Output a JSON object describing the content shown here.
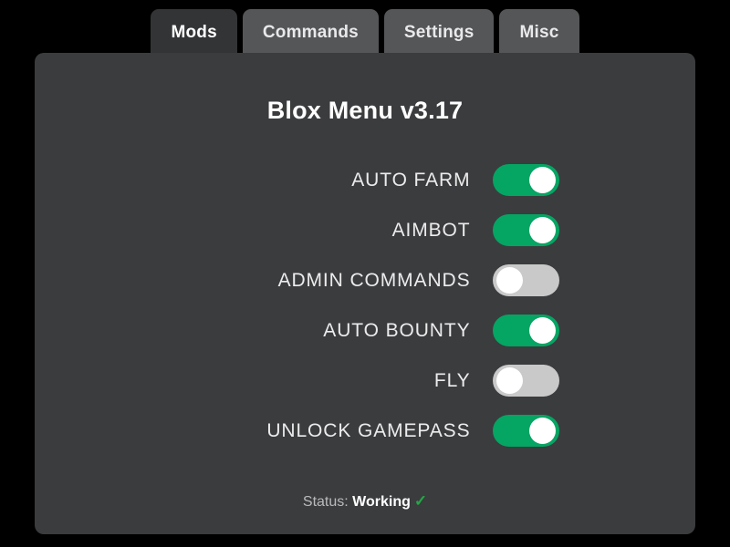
{
  "window": {
    "background_color": "#000000",
    "panel_color": "#3b3c3e"
  },
  "tabs": {
    "items": [
      {
        "label": "Mods",
        "active": true
      },
      {
        "label": "Commands",
        "active": false
      },
      {
        "label": "Settings",
        "active": false
      },
      {
        "label": "Misc",
        "active": false
      }
    ],
    "active_color": "#333436",
    "inactive_color": "#555658"
  },
  "panel": {
    "title": "Blox Menu v3.17",
    "toggles": [
      {
        "label": "AUTO FARM",
        "state": "on",
        "state_label": "ON"
      },
      {
        "label": "AIMBOT",
        "state": "on",
        "state_label": "ON"
      },
      {
        "label": "ADMIN COMMANDS",
        "state": "off",
        "state_label": "OFF"
      },
      {
        "label": "AUTO BOUNTY",
        "state": "on",
        "state_label": "ON"
      },
      {
        "label": "FLY",
        "state": "off",
        "state_label": "OFF"
      },
      {
        "label": "UNLOCK GAMEPASS",
        "state": "on",
        "state_label": "ON"
      }
    ],
    "toggle_on_color": "#05a563",
    "toggle_off_color": "#c9c9c9",
    "knob_color": "#ffffff"
  },
  "status": {
    "prefix": "Status:",
    "value": "Working",
    "icon": "check-icon",
    "icon_glyph": "✓",
    "icon_color": "#22a845"
  }
}
